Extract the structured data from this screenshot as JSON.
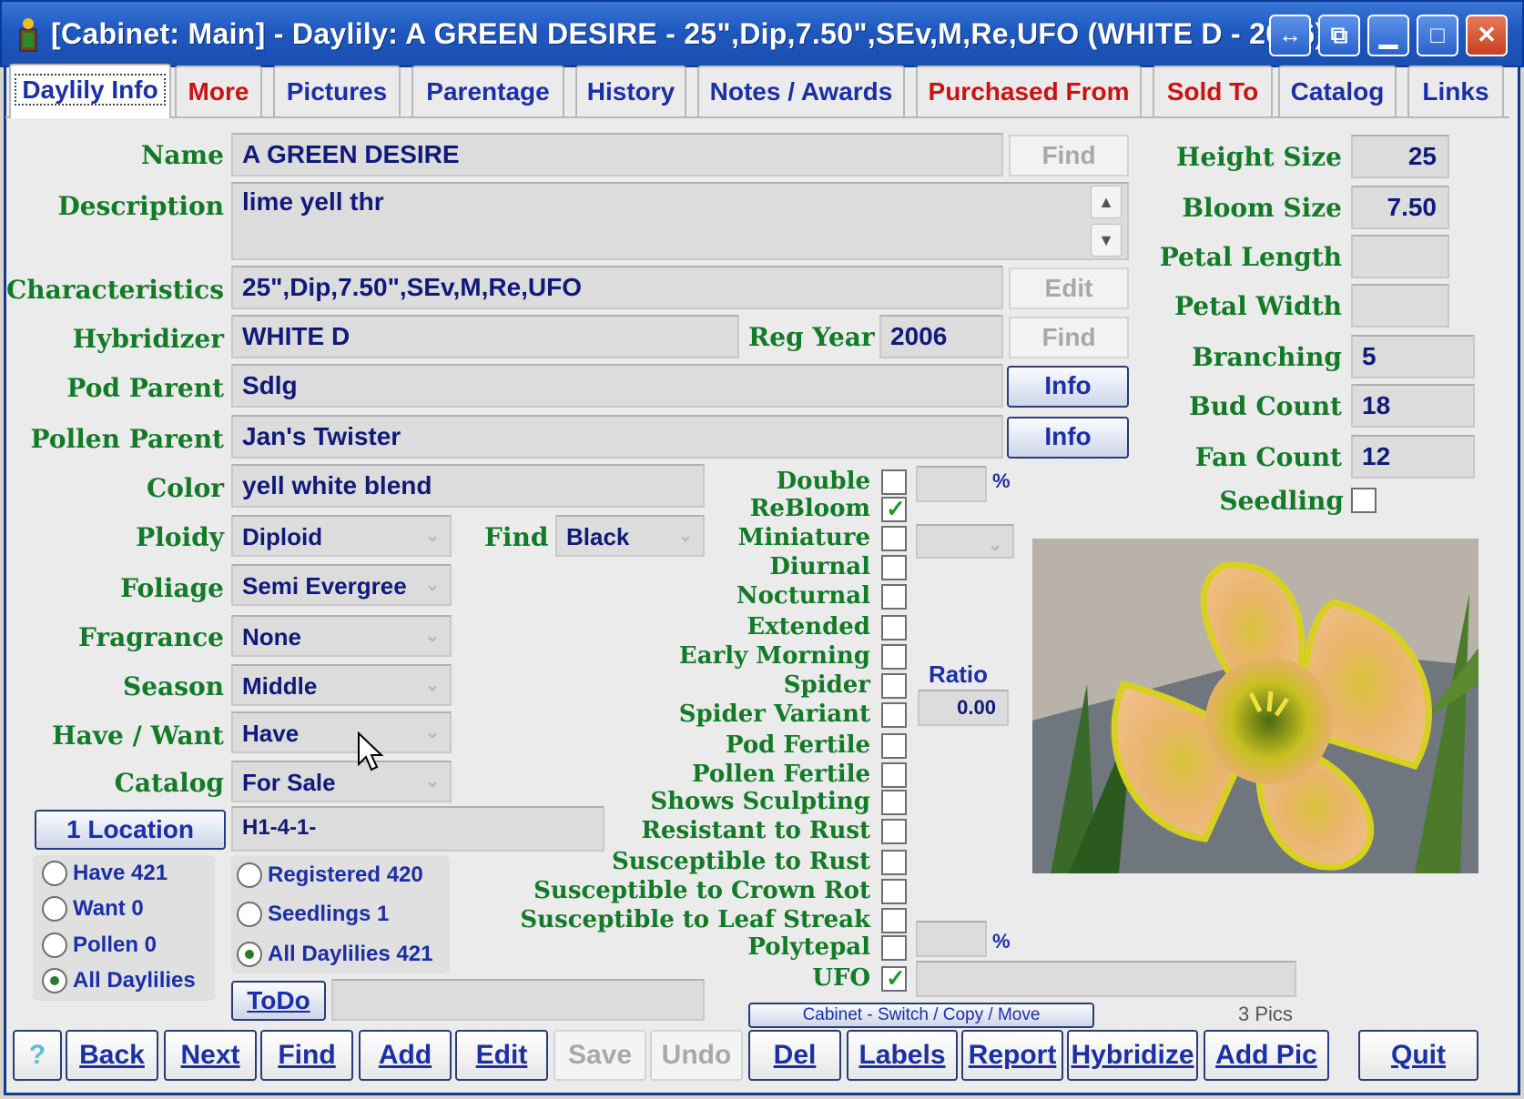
{
  "window": {
    "title": "[Cabinet: Main] - Daylily: A GREEN DESIRE - 25\",Dip,7.50\",SEv,M,Re,UFO (WHITE D - 2006)",
    "controls": {
      "restore_alt": "↔",
      "tile": "⧉",
      "minimize": "▁",
      "maximize": "□",
      "close": "✕"
    }
  },
  "tabs": [
    {
      "label": "Daylily Info"
    },
    {
      "label": "More"
    },
    {
      "label": "Pictures"
    },
    {
      "label": "Parentage"
    },
    {
      "label": "History"
    },
    {
      "label": "Notes / Awards"
    },
    {
      "label": "Purchased From"
    },
    {
      "label": "Sold To"
    },
    {
      "label": "Catalog"
    },
    {
      "label": "Links"
    }
  ],
  "labels": {
    "name": "Name",
    "description": "Description",
    "characteristics": "Characteristics",
    "hybridizer": "Hybridizer",
    "reg_year": "Reg Year",
    "pod_parent": "Pod Parent",
    "pollen_parent": "Pollen Parent",
    "color": "Color",
    "ploidy": "Ploidy",
    "find": "Find",
    "foliage": "Foliage",
    "fragrance": "Fragrance",
    "season": "Season",
    "have_want": "Have / Want",
    "catalog": "Catalog",
    "height_size": "Height Size",
    "bloom_size": "Bloom Size",
    "petal_length": "Petal Length",
    "petal_width": "Petal Width",
    "branching": "Branching",
    "bud_count": "Bud Count",
    "fan_count": "Fan Count",
    "seedling": "Seedling",
    "ratio": "Ratio",
    "percent": "%",
    "pics": "3 Pics"
  },
  "fields": {
    "name": "A GREEN DESIRE",
    "description": "lime yell thr",
    "characteristics": "25\",Dip,7.50\",SEv,M,Re,UFO",
    "hybridizer": "WHITE D",
    "reg_year": "2006",
    "pod_parent": "Sdlg",
    "pollen_parent": "Jan's Twister",
    "color": "yell white blend",
    "ploidy": "Diploid",
    "find_color": "Black",
    "foliage": "Semi Evergree",
    "fragrance": "None",
    "season": "Middle",
    "have_want": "Have",
    "catalog": "For Sale",
    "location": "H1-4-1-",
    "height_size": "25",
    "bloom_size": "7.50",
    "petal_length": "",
    "petal_width": "",
    "branching": "5",
    "bud_count": "18",
    "fan_count": "12",
    "ratio": "0.00"
  },
  "buttons": {
    "find_name": "Find",
    "edit_char": "Edit",
    "find_hyb": "Find",
    "info_pod": "Info",
    "info_pollen": "Info",
    "location": "1 Location",
    "todo": "ToDo",
    "cabinet": "Cabinet - Switch / Copy / Move"
  },
  "checkboxes": [
    {
      "label": "Double",
      "checked": false
    },
    {
      "label": "ReBloom",
      "checked": true
    },
    {
      "label": "Miniature",
      "checked": false
    },
    {
      "label": "Diurnal",
      "checked": false
    },
    {
      "label": "Nocturnal",
      "checked": false
    },
    {
      "label": "Extended",
      "checked": false
    },
    {
      "label": "Early Morning",
      "checked": false
    },
    {
      "label": "Spider",
      "checked": false
    },
    {
      "label": "Spider Variant",
      "checked": false
    },
    {
      "label": "Pod Fertile",
      "checked": false
    },
    {
      "label": "Pollen Fertile",
      "checked": false
    },
    {
      "label": "Shows Sculpting",
      "checked": false
    },
    {
      "label": "Resistant to Rust",
      "checked": false
    },
    {
      "label": "Susceptible to Rust",
      "checked": false
    },
    {
      "label": "Susceptible to Crown Rot",
      "checked": false
    },
    {
      "label": "Susceptible to Leaf Streak",
      "checked": false
    },
    {
      "label": "Polytepal",
      "checked": false
    },
    {
      "label": "UFO",
      "checked": true
    }
  ],
  "radios_left": [
    {
      "label": "Have 421",
      "on": false
    },
    {
      "label": "Want 0",
      "on": false
    },
    {
      "label": "Pollen 0",
      "on": false
    },
    {
      "label": "All Daylilies",
      "on": true
    }
  ],
  "radios_right": [
    {
      "label": "Registered 420",
      "on": false
    },
    {
      "label": "Seedlings 1",
      "on": false
    },
    {
      "label": "All Daylilies 421",
      "on": true
    }
  ],
  "bottom_buttons": [
    {
      "label": "?",
      "disabled": false
    },
    {
      "label": "Back",
      "disabled": false
    },
    {
      "label": "Next",
      "disabled": false
    },
    {
      "label": "Find",
      "disabled": false
    },
    {
      "label": "Add",
      "disabled": false
    },
    {
      "label": "Edit",
      "disabled": false
    },
    {
      "label": "Save",
      "disabled": true
    },
    {
      "label": "Undo",
      "disabled": true
    },
    {
      "label": "Del",
      "disabled": false
    },
    {
      "label": "Labels",
      "disabled": false
    },
    {
      "label": "Report",
      "disabled": false
    },
    {
      "label": "Hybridize",
      "disabled": false
    },
    {
      "label": "Add Pic",
      "disabled": false
    },
    {
      "label": "Quit",
      "disabled": false
    }
  ],
  "colors": {
    "label_green": "#137a28",
    "value_navy": "#101a7a",
    "tab_red": "#cc1212",
    "title_blue": "#1f58c0"
  }
}
